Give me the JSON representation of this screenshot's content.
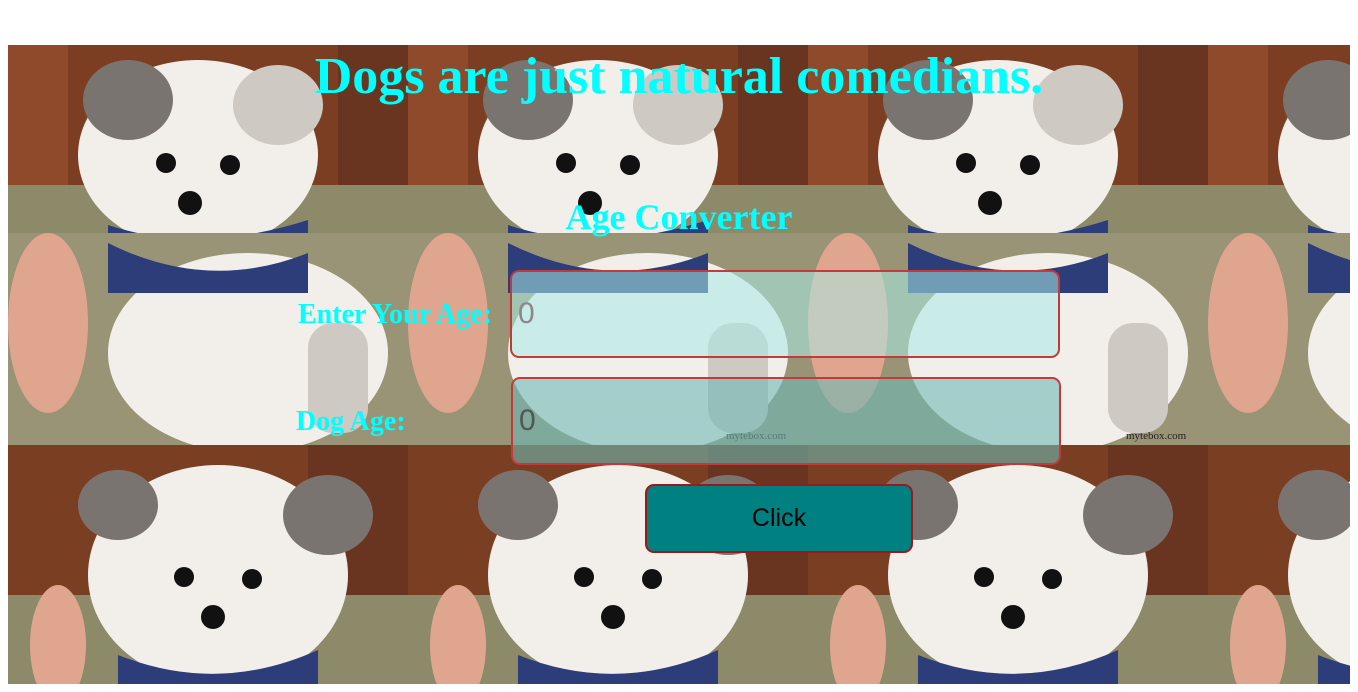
{
  "headline": "Dogs are just natural comedians.",
  "converter": {
    "title": "Age Converter",
    "age_label": "Enter Your Age:",
    "age_placeholder": "0",
    "dog_label": "Dog Age:",
    "dog_placeholder": "0",
    "button_label": "Click"
  },
  "background": {
    "watermark": "mytebox.com"
  },
  "colors": {
    "text_accent": "#00ffff",
    "button_bg": "#008080",
    "field_border": "#c23a3a"
  }
}
